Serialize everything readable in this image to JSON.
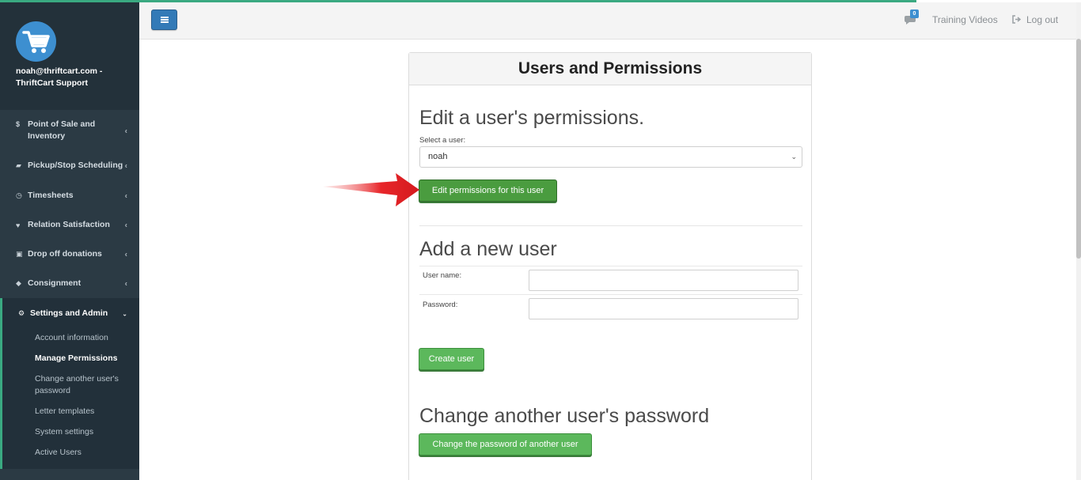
{
  "sidebar": {
    "profile_name": "noah@thriftcart.com - ThriftCart Support",
    "items": [
      {
        "icon": "$",
        "icon_name": "dollar-icon",
        "label": "Point of Sale and Inventory"
      },
      {
        "icon": "🚚",
        "icon_name": "truck-icon",
        "label": "Pickup/Stop Scheduling"
      },
      {
        "icon": "◷",
        "icon_name": "clock-icon",
        "label": "Timesheets"
      },
      {
        "icon": "♥",
        "icon_name": "heart-icon",
        "label": "Relation Satisfaction"
      },
      {
        "icon": "🎁",
        "icon_name": "gift-icon",
        "label": "Drop off donations"
      },
      {
        "icon": "🏷",
        "icon_name": "tags-icon",
        "label": "Consignment"
      },
      {
        "icon": "⚙",
        "icon_name": "gear-icon",
        "label": "Settings and Admin"
      }
    ],
    "sub_items": [
      "Account information",
      "Manage Permissions",
      "Change another user's password",
      "Letter templates",
      "System settings",
      "Active Users"
    ]
  },
  "topbar": {
    "notification_count": "0",
    "training_videos": "Training Videos",
    "log_out": "Log out"
  },
  "panel": {
    "title": "Users and Permissions",
    "edit_heading": "Edit a user's permissions.",
    "select_label": "Select a user:",
    "selected_user": "noah",
    "edit_button": "Edit permissions for this user",
    "add_heading": "Add a new user",
    "username_label": "User name:",
    "password_label": "Password:",
    "create_button": "Create user",
    "change_heading": "Change another user's password",
    "change_button": "Change the password of another user"
  },
  "colors": {
    "sidebar_bg": "#2b3a44",
    "accent_green": "#3aa981",
    "button_green": "#5cb85c",
    "brand_blue": "#3d8fd0"
  }
}
